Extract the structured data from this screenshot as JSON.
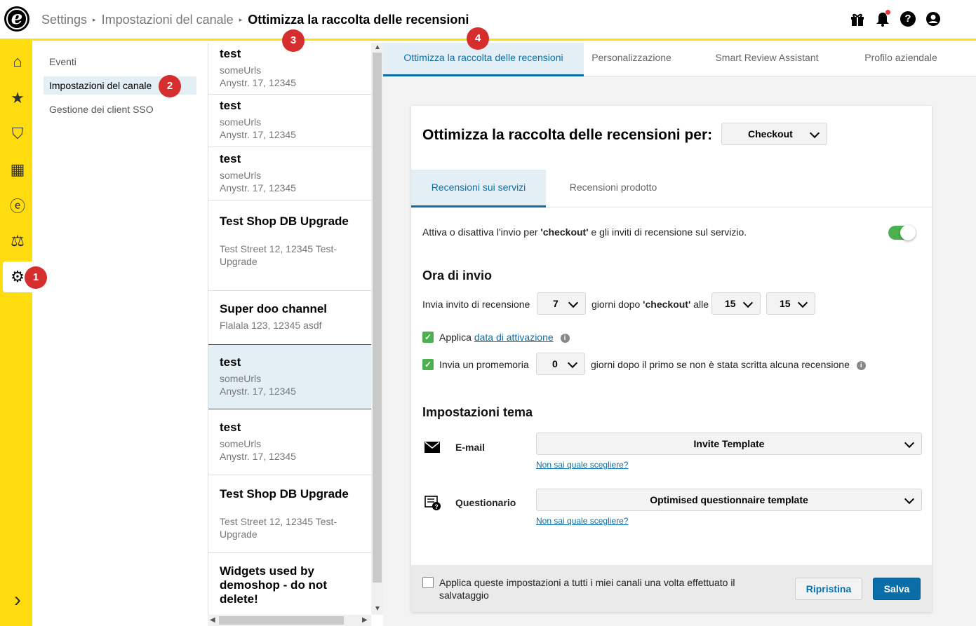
{
  "header": {
    "logo_letter": "e",
    "breadcrumb": [
      "Settings",
      "Impostazioni del canale",
      "Ottimizza la raccolta delle recensioni"
    ],
    "separator": "▸",
    "icons": [
      "gift-icon",
      "bell-icon",
      "help-icon",
      "user-icon"
    ],
    "help_glyph": "?"
  },
  "rail": {
    "items": [
      "home-icon",
      "star-icon",
      "shield-check-icon",
      "chart-icon",
      "e-logo-icon",
      "scales-icon",
      "gear-icon"
    ],
    "glyphs": [
      "⌂",
      "★",
      "⛉",
      "▦",
      "ⓔ",
      "⚖",
      "⚙"
    ],
    "expand": "›"
  },
  "subnav": {
    "items": [
      "Eventi",
      "Impostazioni del canale",
      "Gestione dei client SSO"
    ]
  },
  "channels": [
    {
      "name": "test",
      "line1": "someUrls",
      "line2": "Anystr. 17, 12345"
    },
    {
      "name": "test",
      "line1": "someUrls",
      "line2": "Anystr. 17, 12345"
    },
    {
      "name": "test",
      "line1": "someUrls",
      "line2": "Anystr. 17, 12345"
    },
    {
      "name": "Test Shop DB Upgrade",
      "line1": "Test Street 12, 12345 Test-",
      "line2": "Upgrade"
    },
    {
      "name": "Super doo channel",
      "line1": "Flalala 123, 12345 asdf",
      "line2": ""
    },
    {
      "name": "test",
      "line1": "someUrls",
      "line2": "Anystr. 17, 12345"
    },
    {
      "name": "test",
      "line1": "someUrls",
      "line2": "Anystr. 17, 12345"
    },
    {
      "name": "Test Shop DB Upgrade",
      "line1": "Test Street 12, 12345 Test-",
      "line2": "Upgrade"
    },
    {
      "name": "Widgets used by demoshop - do not delete!",
      "line1": "",
      "line2": ""
    }
  ],
  "tabs": [
    "Ottimizza la raccolta delle recensioni",
    "Personalizzazione",
    "Smart Review Assistant",
    "Profilo aziendale"
  ],
  "card": {
    "title": "Ottimizza la raccolta delle recensioni per:",
    "event_select": "Checkout",
    "subtabs": [
      "Recensioni sui servizi",
      "Recensioni prodotto"
    ],
    "toggle_text_pre": "Attiva o disattiva l'invio per ",
    "toggle_text_bold": "'checkout'",
    "toggle_text_post": " e gli inviti di recensione sul servizio.",
    "send_time_heading": "Ora di invio",
    "invite_label": "Invia invito di recensione",
    "invite_days": "7",
    "days_after_pre": "giorni dopo ",
    "days_after_bold": "'checkout'",
    "days_after_post": " alle",
    "hour": "15",
    "minute": "15",
    "apply_label": "Applica",
    "activation_link": "data di attivazione",
    "reminder_label": "Invia un promemoria",
    "reminder_days": "0",
    "reminder_suffix": "giorni dopo il primo se non è stata scritta alcuna recensione",
    "theme_heading": "Impostazioni tema",
    "email_label": "E-mail",
    "email_template": "Invite Template",
    "help_link": "Non sai quale scegliere?",
    "questionnaire_label": "Questionario",
    "questionnaire_template": "Optimised questionnaire template",
    "apply_all": "Applica queste impostazioni a tutti i miei canali una volta effettuato il salvataggio",
    "reset_button": "Ripristina",
    "save_button": "Salva",
    "info_glyph": "i",
    "check_glyph": "✓"
  },
  "badges": [
    "1",
    "2",
    "3",
    "4"
  ],
  "colors": {
    "accent": "#0a6fa8",
    "rail": "#ffdc0f",
    "toggle_on": "#4caf50",
    "badge": "#d62e2e"
  }
}
